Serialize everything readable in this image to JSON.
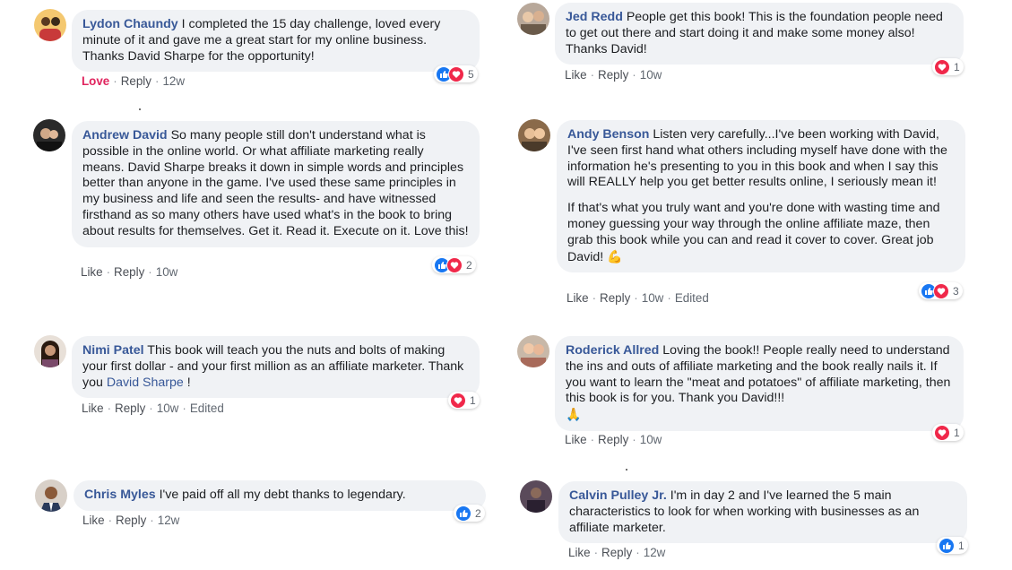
{
  "comments": [
    {
      "name": "Lydon Chaundy",
      "text": "I completed the 15 day challenge, loved every minute of it and gave me a great start for my online business. Thanks David Sharpe for the opportunity!",
      "reaction_label": "Love",
      "reply": "Reply",
      "time": "12w",
      "count": "5"
    },
    {
      "name": "Jed Redd",
      "text": "People get this book! This is the foundation people need to get out there and start doing it and make some money also! Thanks David!",
      "like": "Like",
      "reply": "Reply",
      "time": "10w",
      "count": "1"
    },
    {
      "name": "Andrew David",
      "text": "So many people still don't understand what is possible in the online world. Or what affiliate marketing really means. David Sharpe breaks it down in simple words and principles better than anyone in the game. I've used these same principles in my business and life and seen the results- and have witnessed firsthand as so many others have used what's in the book to bring about results for themselves. Get it. Read it. Execute on it. Love this!",
      "like": "Like",
      "reply": "Reply",
      "time": "10w",
      "count": "2"
    },
    {
      "name": "Andy Benson",
      "text": "Listen very carefully...I've been working with David, I've seen first hand what others including myself have done with the information he's presenting to you in this book and when I say this will REALLY help you get better results online, I seriously mean it!",
      "text2": "If that's what you truly want and you're done with wasting time and money guessing your way through the online affiliate maze, then grab this book while you can and read it cover to cover. Great job David!",
      "like": "Like",
      "reply": "Reply",
      "time": "10w",
      "edited": "Edited",
      "count": "3"
    },
    {
      "name": "Nimi Patel",
      "text": "This book will teach you the nuts and bolts of making your first dollar - and your first million as an affiliate marketer. Thank you",
      "mention": "David Sharpe",
      "after": " !",
      "like": "Like",
      "reply": "Reply",
      "time": "10w",
      "edited": "Edited",
      "count": "1"
    },
    {
      "name": "Roderick Allred",
      "text": "Loving the book!! People really need to understand the ins and outs of affiliate marketing and the book really nails it. If you want to learn the \"meat and potatoes\" of affiliate marketing, then this book is for you. Thank you David!!!",
      "like": "Like",
      "reply": "Reply",
      "time": "10w",
      "count": "1"
    },
    {
      "name": "Chris Myles",
      "text": "I've paid off all my debt thanks to legendary.",
      "like": "Like",
      "reply": "Reply",
      "time": "12w",
      "count": "2"
    },
    {
      "name": "Calvin Pulley Jr.",
      "text": "I'm in day 2 and I've learned the 5 main characteristics to look for when working with businesses as an affiliate marketer.",
      "like": "Like",
      "reply": "Reply",
      "time": "12w",
      "count": "1"
    }
  ],
  "separator": "·",
  "colors": {
    "bubble": "#f0f2f5",
    "name": "#385898",
    "like": "#1877f2",
    "love": "#f0284a",
    "love_text": "#e0245e"
  }
}
